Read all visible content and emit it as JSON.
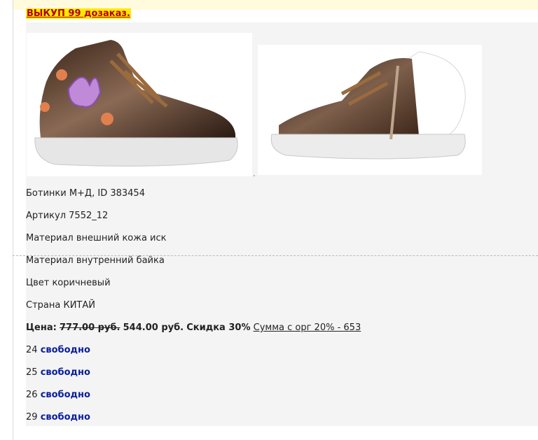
{
  "promo": {
    "text": "ВЫКУП 99 дозаказ."
  },
  "product": {
    "name_line": "Ботинки М+Д, ID 383454",
    "article_line": "Артикул 7552_12",
    "material_outer_line": "Материал внешний кожа иск",
    "material_inner_line": "Материал внутренний байка",
    "color_line": "Цвет коричневый",
    "country_line": "Страна КИТАЙ",
    "images": [
      {
        "icon": "shoe-side-view-image"
      },
      {
        "icon": "shoe-zipper-view-image"
      }
    ],
    "image_tick": "-"
  },
  "price": {
    "label": "Цена:",
    "old": "777.00 руб.",
    "new": "544.00 руб.",
    "discount": "Скидка 30%",
    "sum_link": "Сумма с орг 20% - 653"
  },
  "sizes": [
    {
      "size": "24",
      "status": "свободно"
    },
    {
      "size": "25",
      "status": "свободно"
    },
    {
      "size": "26",
      "status": "свободно"
    },
    {
      "size": "29",
      "status": "свободно"
    }
  ],
  "colors": {
    "promo_bg": "#ffea00",
    "promo_text": "#b00000",
    "status_free": "#0a1e9c",
    "panel_bg": "#f4f4f4"
  }
}
